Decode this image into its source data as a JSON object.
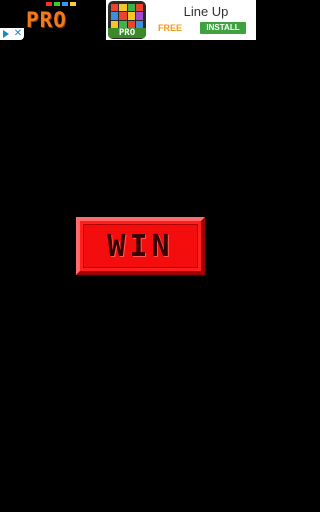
{
  "ad": {
    "left_logo_text": "PRO",
    "choices_close": "✕",
    "app_icon_label": "PRO",
    "title": "Line Up",
    "free_label": "FREE",
    "install_label": "INSTALL",
    "colors": {
      "logo_orange": "#f27a1b",
      "install_green": "#3ea33e",
      "free_orange": "#f29a1b"
    }
  },
  "game": {
    "button_label": "WIN",
    "colors": {
      "background": "#000000",
      "button_red": "#ff1f1f",
      "button_text": "#3a0000"
    }
  }
}
